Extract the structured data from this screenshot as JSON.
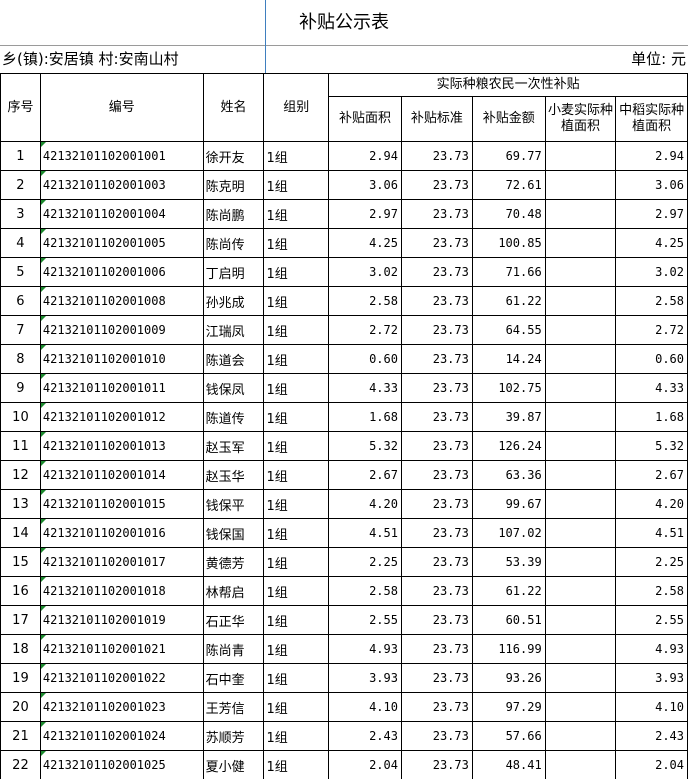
{
  "title": "补贴公示表",
  "location": "乡(镇):安居镇 村:安南山村",
  "unit": "单位: 元",
  "headers": {
    "seq": "序号",
    "code": "编号",
    "name": "姓名",
    "group": "组别",
    "subsidy_group": "实际种粮农民一次性补贴",
    "area": "补贴面积",
    "standard": "补贴标准",
    "amount": "补贴金额",
    "wheat": "小麦实际种植面积",
    "rice": "中稻实际种植面积"
  },
  "rows": [
    {
      "seq": "1",
      "code": "42132101102001001",
      "name": "徐开友",
      "group": "1组",
      "area": "2.94",
      "standard": "23.73",
      "amount": "69.77",
      "wheat": "",
      "rice": "2.94"
    },
    {
      "seq": "2",
      "code": "42132101102001003",
      "name": "陈克明",
      "group": "1组",
      "area": "3.06",
      "standard": "23.73",
      "amount": "72.61",
      "wheat": "",
      "rice": "3.06"
    },
    {
      "seq": "3",
      "code": "42132101102001004",
      "name": "陈尚鹏",
      "group": "1组",
      "area": "2.97",
      "standard": "23.73",
      "amount": "70.48",
      "wheat": "",
      "rice": "2.97"
    },
    {
      "seq": "4",
      "code": "42132101102001005",
      "name": "陈尚传",
      "group": "1组",
      "area": "4.25",
      "standard": "23.73",
      "amount": "100.85",
      "wheat": "",
      "rice": "4.25"
    },
    {
      "seq": "5",
      "code": "42132101102001006",
      "name": "丁启明",
      "group": "1组",
      "area": "3.02",
      "standard": "23.73",
      "amount": "71.66",
      "wheat": "",
      "rice": "3.02"
    },
    {
      "seq": "6",
      "code": "42132101102001008",
      "name": "孙兆成",
      "group": "1组",
      "area": "2.58",
      "standard": "23.73",
      "amount": "61.22",
      "wheat": "",
      "rice": "2.58"
    },
    {
      "seq": "7",
      "code": "42132101102001009",
      "name": "江瑞凤",
      "group": "1组",
      "area": "2.72",
      "standard": "23.73",
      "amount": "64.55",
      "wheat": "",
      "rice": "2.72"
    },
    {
      "seq": "8",
      "code": "42132101102001010",
      "name": "陈道会",
      "group": "1组",
      "area": "0.60",
      "standard": "23.73",
      "amount": "14.24",
      "wheat": "",
      "rice": "0.60"
    },
    {
      "seq": "9",
      "code": "42132101102001011",
      "name": "钱保凤",
      "group": "1组",
      "area": "4.33",
      "standard": "23.73",
      "amount": "102.75",
      "wheat": "",
      "rice": "4.33"
    },
    {
      "seq": "10",
      "code": "42132101102001012",
      "name": "陈道传",
      "group": "1组",
      "area": "1.68",
      "standard": "23.73",
      "amount": "39.87",
      "wheat": "",
      "rice": "1.68"
    },
    {
      "seq": "11",
      "code": "42132101102001013",
      "name": "赵玉军",
      "group": "1组",
      "area": "5.32",
      "standard": "23.73",
      "amount": "126.24",
      "wheat": "",
      "rice": "5.32"
    },
    {
      "seq": "12",
      "code": "42132101102001014",
      "name": "赵玉华",
      "group": "1组",
      "area": "2.67",
      "standard": "23.73",
      "amount": "63.36",
      "wheat": "",
      "rice": "2.67"
    },
    {
      "seq": "13",
      "code": "42132101102001015",
      "name": "钱保平",
      "group": "1组",
      "area": "4.20",
      "standard": "23.73",
      "amount": "99.67",
      "wheat": "",
      "rice": "4.20"
    },
    {
      "seq": "14",
      "code": "42132101102001016",
      "name": "钱保国",
      "group": "1组",
      "area": "4.51",
      "standard": "23.73",
      "amount": "107.02",
      "wheat": "",
      "rice": "4.51"
    },
    {
      "seq": "15",
      "code": "42132101102001017",
      "name": "黄德芳",
      "group": "1组",
      "area": "2.25",
      "standard": "23.73",
      "amount": "53.39",
      "wheat": "",
      "rice": "2.25"
    },
    {
      "seq": "16",
      "code": "42132101102001018",
      "name": "林帮启",
      "group": "1组",
      "area": "2.58",
      "standard": "23.73",
      "amount": "61.22",
      "wheat": "",
      "rice": "2.58"
    },
    {
      "seq": "17",
      "code": "42132101102001019",
      "name": "石正华",
      "group": "1组",
      "area": "2.55",
      "standard": "23.73",
      "amount": "60.51",
      "wheat": "",
      "rice": "2.55"
    },
    {
      "seq": "18",
      "code": "42132101102001021",
      "name": "陈尚青",
      "group": "1组",
      "area": "4.93",
      "standard": "23.73",
      "amount": "116.99",
      "wheat": "",
      "rice": "4.93"
    },
    {
      "seq": "19",
      "code": "42132101102001022",
      "name": "石中奎",
      "group": "1组",
      "area": "3.93",
      "standard": "23.73",
      "amount": "93.26",
      "wheat": "",
      "rice": "3.93"
    },
    {
      "seq": "20",
      "code": "42132101102001023",
      "name": "王芳信",
      "group": "1组",
      "area": "4.10",
      "standard": "23.73",
      "amount": "97.29",
      "wheat": "",
      "rice": "4.10"
    },
    {
      "seq": "21",
      "code": "42132101102001024",
      "name": "苏顺芳",
      "group": "1组",
      "area": "2.43",
      "standard": "23.73",
      "amount": "57.66",
      "wheat": "",
      "rice": "2.43"
    },
    {
      "seq": "22",
      "code": "42132101102001025",
      "name": "夏小健",
      "group": "1组",
      "area": "2.04",
      "standard": "23.73",
      "amount": "48.41",
      "wheat": "",
      "rice": "2.04"
    }
  ]
}
